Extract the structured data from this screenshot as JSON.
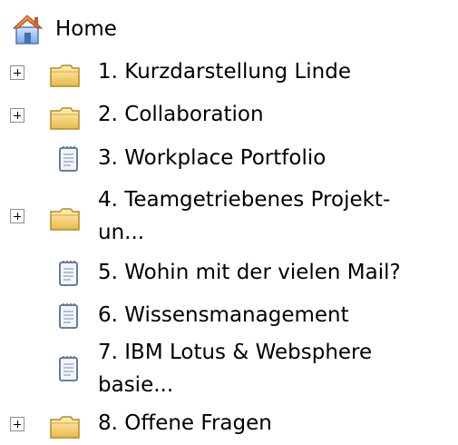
{
  "tree": {
    "home_label": "Home",
    "items": [
      {
        "label": "1. Kurzdarstellung Linde"
      },
      {
        "label": "2. Collaboration"
      },
      {
        "label": "3. Workplace Portfolio"
      },
      {
        "label_line1": "4. Teamgetriebenes Projekt-",
        "label_line2": "un..."
      },
      {
        "label": "5. Wohin mit der vielen Mail?"
      },
      {
        "label": "6. Wissensmanagement"
      },
      {
        "label_line1": "7. IBM Lotus & Websphere",
        "label_line2": "basie..."
      },
      {
        "label": "8. Offene Fragen"
      }
    ],
    "icons": {
      "home": "home-icon",
      "folder": "folder-icon",
      "document": "document-icon",
      "expand": "plus-expand-icon"
    },
    "colors": {
      "folder_fill": "#F5D88A",
      "folder_border": "#B48A2A",
      "document_border": "#5A6E8A"
    }
  }
}
